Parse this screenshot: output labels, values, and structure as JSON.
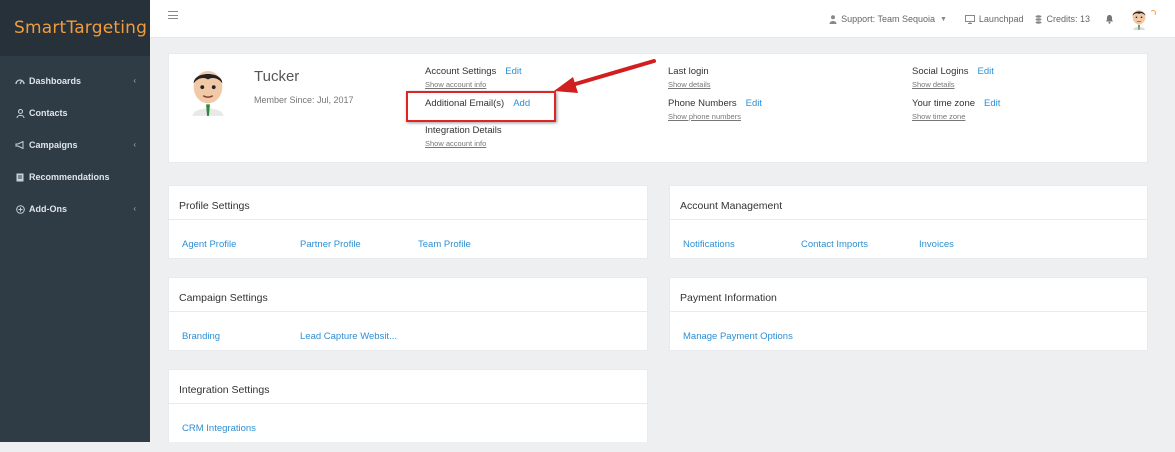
{
  "app": {
    "name": "SmartTargeting"
  },
  "colors": {
    "accent": "#2e8fd4",
    "brand": "#f39c3c",
    "sidebar": "#2f3b45",
    "highlight": "#e02424"
  },
  "sidebar": {
    "items": [
      {
        "label": "Dashboards",
        "icon": "dashboard-icon",
        "has_chevron": true
      },
      {
        "label": "Contacts",
        "icon": "person-icon",
        "has_chevron": false
      },
      {
        "label": "Campaigns",
        "icon": "megaphone-icon",
        "has_chevron": true
      },
      {
        "label": "Recommendations",
        "icon": "list-box-icon",
        "has_chevron": false
      },
      {
        "label": "Add-Ons",
        "icon": "plus-circle-icon",
        "has_chevron": true
      }
    ]
  },
  "topbar": {
    "support": "Support: Team Sequoia",
    "launchpad": "Launchpad",
    "credits": "Credits: 13"
  },
  "profile": {
    "name": "Tucker",
    "member_since": "Member Since: Jul, 2017",
    "account_settings": {
      "label": "Account Settings",
      "action": "Edit",
      "sub": "Show account info"
    },
    "additional_emails": {
      "label": "Additional Email(s)",
      "action": "Add"
    },
    "integration_details": {
      "label": "Integration Details",
      "sub": "Show account info"
    },
    "last_login": {
      "label": "Last login",
      "sub": "Show details"
    },
    "phone_numbers": {
      "label": "Phone Numbers",
      "action": "Edit",
      "sub": "Show phone numbers"
    },
    "social_logins": {
      "label": "Social Logins",
      "action": "Edit",
      "sub": "Show details"
    },
    "time_zone": {
      "label": "Your time zone",
      "action": "Edit",
      "sub": "Show time zone"
    }
  },
  "panels": {
    "profile_settings": {
      "title": "Profile Settings",
      "links": [
        "Agent Profile",
        "Partner Profile",
        "Team Profile"
      ]
    },
    "account_management": {
      "title": "Account Management",
      "links": [
        "Notifications",
        "Contact Imports",
        "Invoices"
      ]
    },
    "campaign_settings": {
      "title": "Campaign Settings",
      "links": [
        "Branding",
        "Lead Capture Websit..."
      ]
    },
    "payment_information": {
      "title": "Payment Information",
      "links": [
        "Manage Payment Options"
      ]
    },
    "integration_settings": {
      "title": "Integration Settings",
      "links": [
        "CRM Integrations"
      ]
    }
  }
}
